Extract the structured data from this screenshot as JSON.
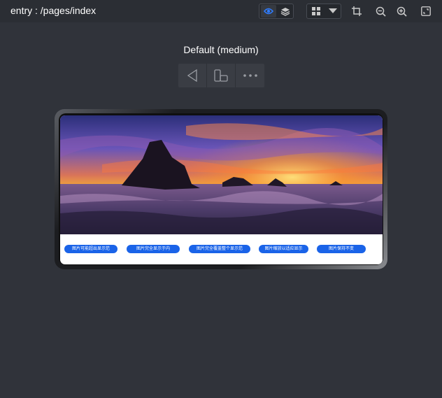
{
  "header": {
    "title": "entry : /pages/index",
    "icons": [
      "eye-icon",
      "layers-icon",
      "grid-icon",
      "caret-down-icon",
      "crop-icon",
      "zoom-out-icon",
      "zoom-in-icon",
      "fit-screen-icon"
    ]
  },
  "device": {
    "label": "Default (medium)",
    "toolbar": [
      "back-triangle-icon",
      "rotate-device-icon",
      "more-icon"
    ]
  },
  "preview": {
    "buttons": [
      {
        "label": "图片可能超出显示范"
      },
      {
        "label": "图片完全显示于内"
      },
      {
        "label": "图片完全覆盖整个显示范"
      },
      {
        "label": "图片缩放以适应显示"
      },
      {
        "label": "图片保持不变"
      }
    ]
  },
  "colors": {
    "background": "#30333a",
    "topbar": "#2b2e34",
    "accent": "#1a63e8",
    "active_icon": "#2f7cff"
  }
}
